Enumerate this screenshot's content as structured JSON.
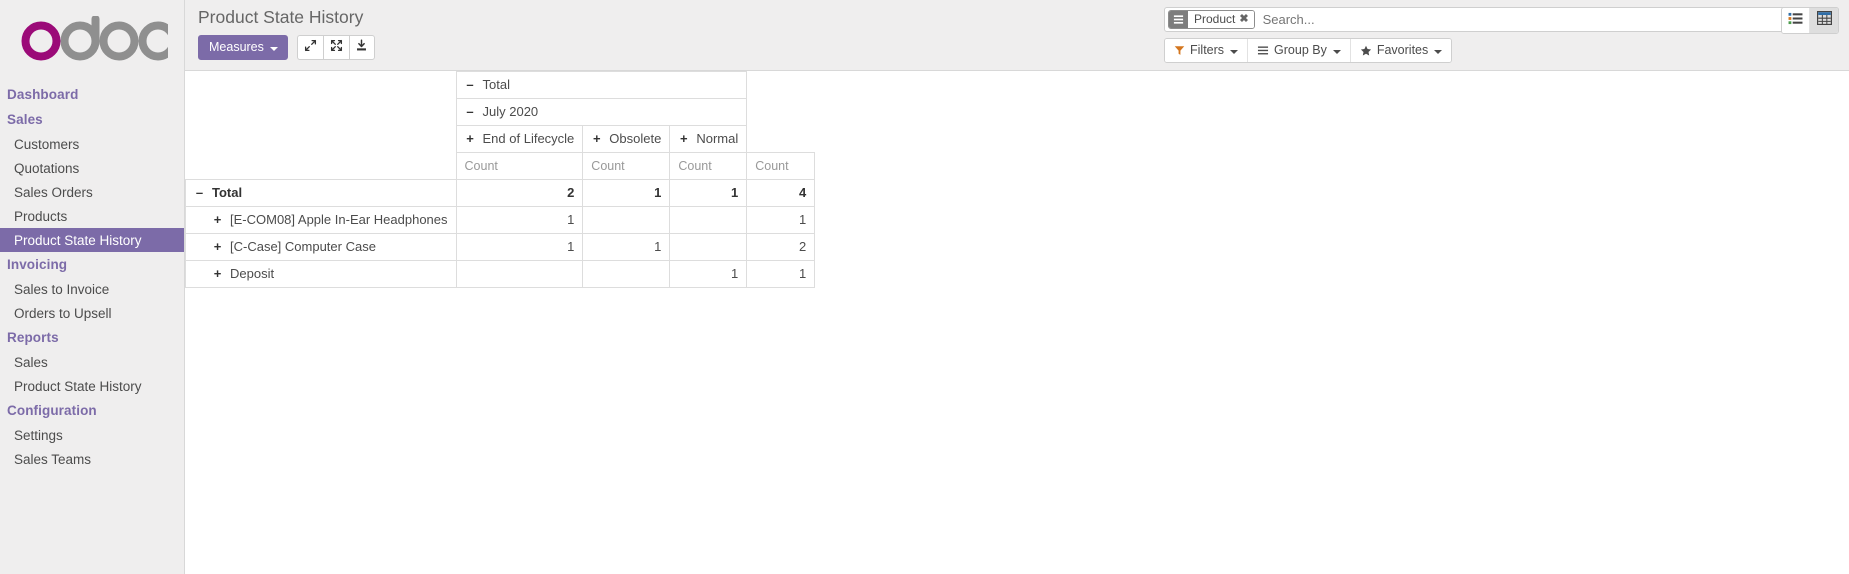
{
  "brand": {
    "logo_text_1": "o",
    "logo_text_2": "doo",
    "accent": "#9b0a78",
    "gray": "#8f8f8f",
    "purple": "#7c6ba8"
  },
  "sidebar": {
    "sections": [
      {
        "name": "Dashboard",
        "type": "section",
        "items": []
      },
      {
        "name": "Sales",
        "type": "section",
        "items": [
          {
            "label": "Customers",
            "active": false
          },
          {
            "label": "Quotations",
            "active": false
          },
          {
            "label": "Sales Orders",
            "active": false
          },
          {
            "label": "Products",
            "active": false
          },
          {
            "label": "Product State History",
            "active": true
          }
        ]
      },
      {
        "name": "Invoicing",
        "type": "section",
        "items": [
          {
            "label": "Sales to Invoice",
            "active": false
          },
          {
            "label": "Orders to Upsell",
            "active": false
          }
        ]
      },
      {
        "name": "Reports",
        "type": "section",
        "items": [
          {
            "label": "Sales",
            "active": false
          },
          {
            "label": "Product State History",
            "active": false
          }
        ]
      },
      {
        "name": "Configuration",
        "type": "section",
        "items": [
          {
            "label": "Settings",
            "active": false
          },
          {
            "label": "Sales Teams",
            "active": false
          }
        ]
      }
    ],
    "labels": {
      "dashboard": "Dashboard",
      "sales": "Sales",
      "customers": "Customers",
      "quotations": "Quotations",
      "sales_orders": "Sales Orders",
      "products": "Products",
      "product_state_history": "Product State History",
      "invoicing": "Invoicing",
      "sales_to_invoice": "Sales to Invoice",
      "orders_to_upsell": "Orders to Upsell",
      "reports": "Reports",
      "reports_sales": "Sales",
      "reports_product_state_history": "Product State History",
      "configuration": "Configuration",
      "settings": "Settings",
      "sales_teams": "Sales Teams"
    }
  },
  "header": {
    "title": "Product State History",
    "measures_label": "Measures",
    "icons": {
      "expand": "expand-arrows-icon",
      "collapse": "collapse-icon",
      "download": "download-icon"
    }
  },
  "search": {
    "facet_label": "Product",
    "facet_remove": "✖",
    "placeholder": "Search...",
    "value": ""
  },
  "filters": {
    "filters_label": "Filters",
    "group_by_label": "Group By",
    "favorites_label": "Favorites"
  },
  "view_switcher": {
    "list_label": "list-view",
    "pivot_label": "pivot-view",
    "active": "pivot"
  },
  "pivot": {
    "col_total_label": "Total",
    "col_period_label": "July 2020",
    "col_groups": [
      {
        "label": "End of Lifecycle",
        "expanded": false
      },
      {
        "label": "Obsolete",
        "expanded": false
      },
      {
        "label": "Normal",
        "expanded": false
      }
    ],
    "measure_label": "Count",
    "measure_headers": [
      "Count",
      "Count",
      "Count",
      "Count"
    ],
    "rows": [
      {
        "label": "Total",
        "expanded": true,
        "indent": 0,
        "bold": true,
        "values": [
          "2",
          "1",
          "1",
          "4"
        ]
      },
      {
        "label": "[E-COM08] Apple In-Ear Headphones",
        "expanded": false,
        "indent": 1,
        "bold": false,
        "values": [
          "1",
          "",
          "",
          "1"
        ]
      },
      {
        "label": "[C-Case] Computer Case",
        "expanded": false,
        "indent": 1,
        "bold": false,
        "values": [
          "1",
          "1",
          "",
          "2"
        ]
      },
      {
        "label": "Deposit",
        "expanded": false,
        "indent": 1,
        "bold": false,
        "values": [
          "",
          "",
          "1",
          "1"
        ]
      }
    ]
  },
  "chart_data": {
    "type": "table",
    "title": "Product State History",
    "row_categories": [
      "[E-COM08] Apple In-Ear Headphones",
      "[C-Case] Computer Case",
      "Deposit"
    ],
    "col_categories": [
      "End of Lifecycle",
      "Obsolete",
      "Normal",
      "Total"
    ],
    "measure": "Count",
    "period": "July 2020",
    "values": [
      [
        1,
        null,
        null,
        1
      ],
      [
        1,
        1,
        null,
        2
      ],
      [
        null,
        null,
        1,
        1
      ]
    ],
    "column_totals": [
      2,
      1,
      1,
      4
    ]
  }
}
